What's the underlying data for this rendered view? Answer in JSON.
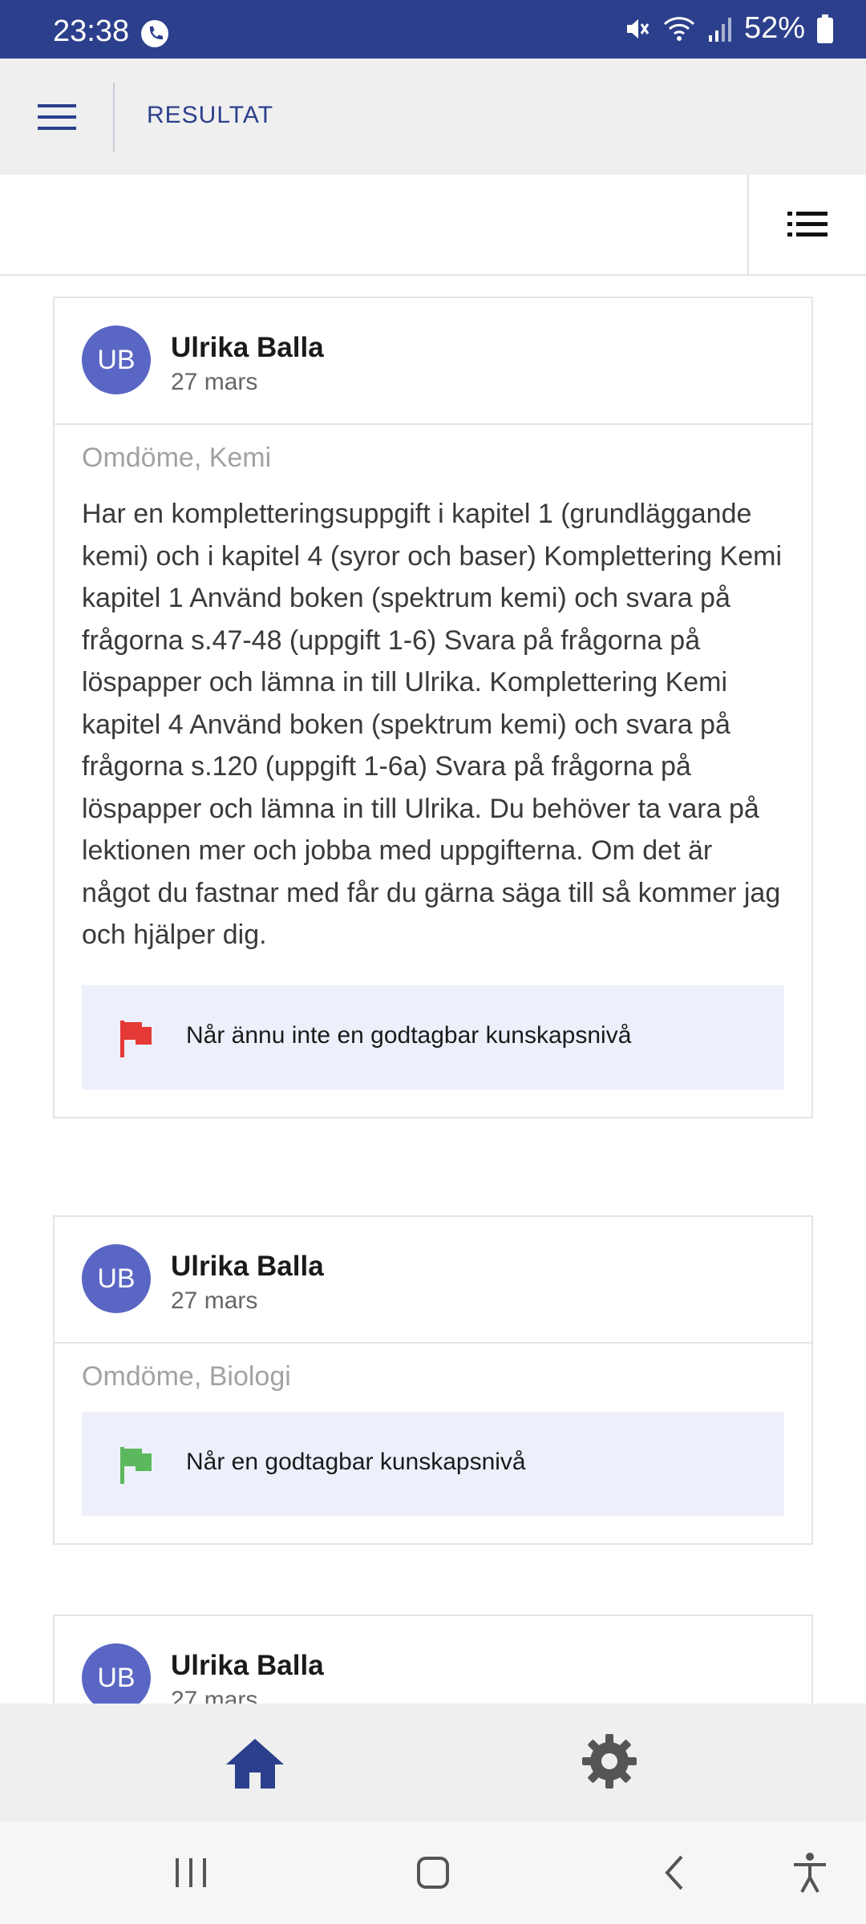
{
  "status_bar": {
    "time": "23:38",
    "battery": "52%",
    "icons": [
      "call-icon",
      "mute-icon",
      "wifi-icon",
      "signal-icon",
      "battery-icon"
    ]
  },
  "header": {
    "title": "RESULTAT",
    "menu_icon": "hamburger-menu-icon"
  },
  "toolbar": {
    "list_icon": "list-view-icon"
  },
  "cards": [
    {
      "initials": "UB",
      "author": "Ulrika Balla",
      "date": "27 mars",
      "subject": "Omdöme, Kemi",
      "comment": "Har en kompletteringsuppgift i kapitel 1 (grundläggande kemi) och i kapitel 4 (syror och baser) Komplettering Kemi kapitel 1 Använd boken (spektrum kemi) och svara på frågorna s.47-48 (uppgift 1-6) Svara på frågorna på löspapper och lämna in till Ulrika. Komplettering Kemi kapitel 4 Använd boken (spektrum kemi) och svara på frågorna s.120 (uppgift 1-6a) Svara på frågorna på löspapper och lämna in till Ulrika. Du behöver ta vara på lektionen mer och jobba med uppgifterna. Om det är något du fastnar med får du gärna säga till så kommer jag och hjälper dig.",
      "status_text": "Når ännu inte en godtagbar kunskapsnivå",
      "flag_color": "#e53935"
    },
    {
      "initials": "UB",
      "author": "Ulrika Balla",
      "date": "27 mars",
      "subject": "Omdöme, Biologi",
      "status_text": "Når en godtagbar kunskapsnivå",
      "flag_color": "#5cb85c"
    },
    {
      "initials": "UB",
      "author": "Ulrika Balla",
      "date": "27 mars"
    }
  ],
  "bottom_nav": {
    "items": [
      "home-icon",
      "settings-icon"
    ],
    "active": "home-icon"
  },
  "colors": {
    "brand": "#2b3f8c",
    "avatar": "#5a66c4",
    "status_bg": "#edf0fb"
  }
}
